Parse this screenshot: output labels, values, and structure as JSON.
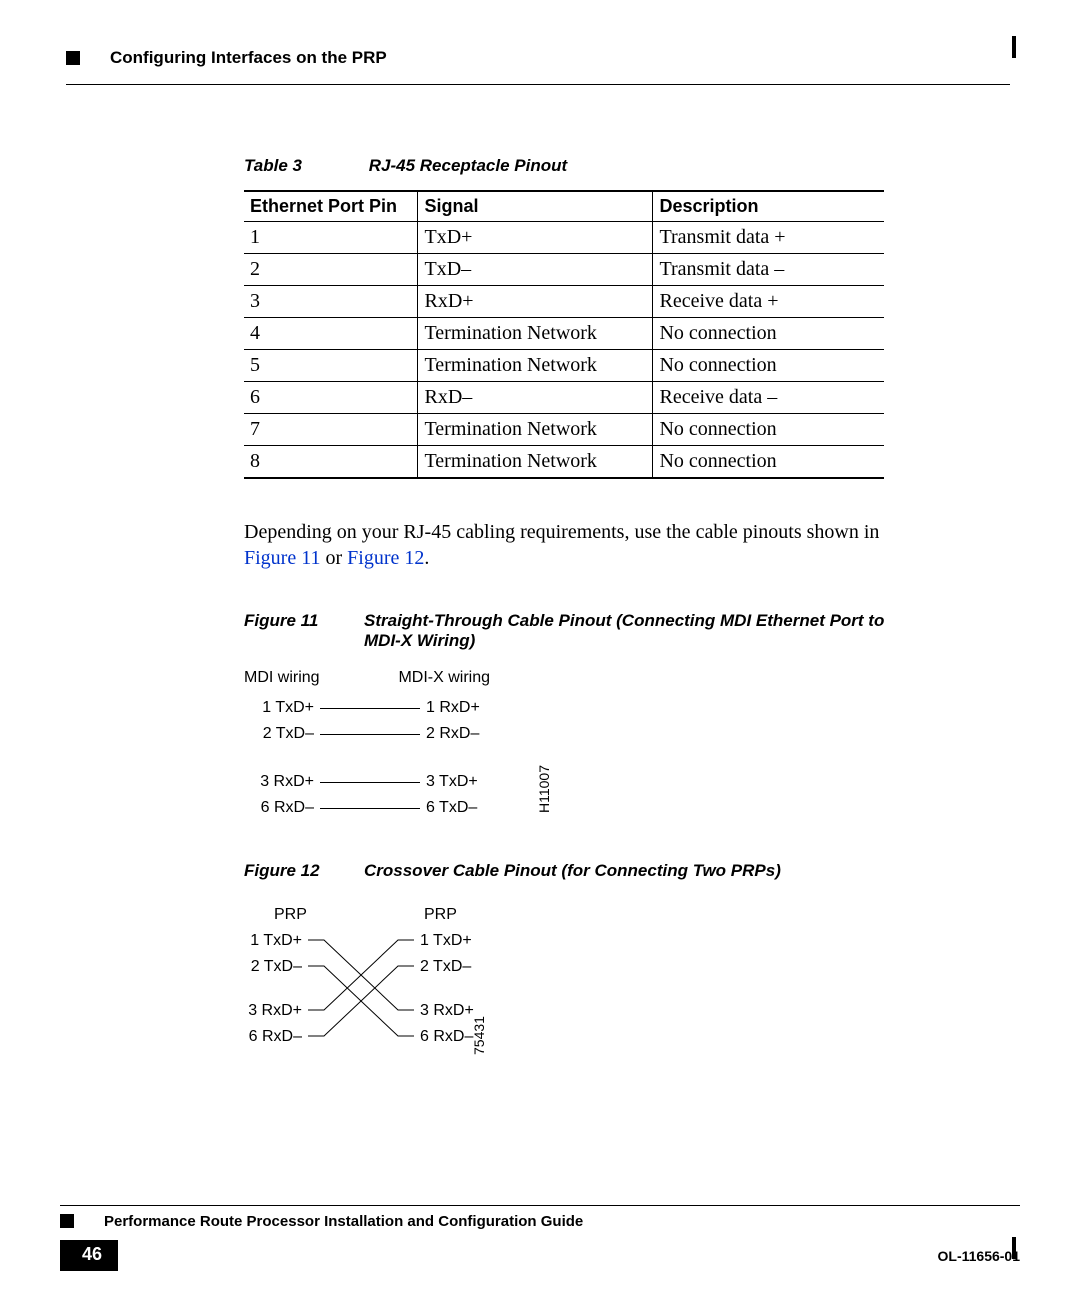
{
  "header": {
    "section_title": "Configuring Interfaces on the PRP"
  },
  "table3": {
    "caption_no": "Table 3",
    "caption_txt": "RJ-45 Receptacle Pinout",
    "headers": {
      "pin": "Ethernet Port Pin",
      "signal": "Signal",
      "desc": "Description"
    },
    "rows": [
      {
        "pin": "1",
        "signal": "TxD+",
        "desc": "Transmit data +"
      },
      {
        "pin": "2",
        "signal": "TxD–",
        "desc": "Transmit data –"
      },
      {
        "pin": "3",
        "signal": "RxD+",
        "desc": "Receive data +"
      },
      {
        "pin": "4",
        "signal": "Termination Network",
        "desc": "No connection"
      },
      {
        "pin": "5",
        "signal": "Termination Network",
        "desc": "No connection"
      },
      {
        "pin": "6",
        "signal": "RxD–",
        "desc": "Receive data –"
      },
      {
        "pin": "7",
        "signal": "Termination Network",
        "desc": "No connection"
      },
      {
        "pin": "8",
        "signal": "Termination Network",
        "desc": "No connection"
      }
    ]
  },
  "para": {
    "text1": "Depending on your RJ-45 cabling requirements, use the cable pinouts shown in ",
    "link1": "Figure 11",
    "mid": " or ",
    "link2": "Figure 12",
    "end": "."
  },
  "fig11": {
    "no": "Figure 11",
    "title": "Straight-Through Cable Pinout (Connecting MDI Ethernet Port to MDI-X Wiring)",
    "left_head": "MDI wiring",
    "right_head": "MDI-X wiring",
    "rows": [
      {
        "l": "1 TxD+",
        "r": "1 RxD+"
      },
      {
        "l": "2 TxD–",
        "r": "2 RxD–"
      },
      {
        "gap": true
      },
      {
        "l": "3 RxD+",
        "r": "3 TxD+"
      },
      {
        "l": "6 RxD–",
        "r": "6 TxD–"
      }
    ],
    "sideid": "H11007"
  },
  "fig12": {
    "no": "Figure 12",
    "title": "Crossover Cable Pinout (for Connecting Two PRPs)",
    "left_head": "PRP",
    "right_head": "PRP",
    "rows": [
      {
        "l": "1 TxD+",
        "r": "1 TxD+"
      },
      {
        "l": "2 TxD–",
        "r": "2 TxD–"
      },
      {
        "l": "3 RxD+",
        "r": "3 RxD+"
      },
      {
        "l": "6 RxD–",
        "r": "6 RxD–"
      }
    ],
    "sideid": "75431"
  },
  "footer": {
    "guide_title": "Performance Route Processor Installation and Configuration Guide",
    "page_no": "46",
    "doc_id": "OL-11656-01"
  },
  "chart_data": [
    {
      "type": "table",
      "title": "RJ-45 Receptacle Pinout",
      "columns": [
        "Ethernet Port Pin",
        "Signal",
        "Description"
      ],
      "rows": [
        [
          "1",
          "TxD+",
          "Transmit data +"
        ],
        [
          "2",
          "TxD–",
          "Transmit data –"
        ],
        [
          "3",
          "RxD+",
          "Receive data +"
        ],
        [
          "4",
          "Termination Network",
          "No connection"
        ],
        [
          "5",
          "Termination Network",
          "No connection"
        ],
        [
          "6",
          "RxD–",
          "Receive data –"
        ],
        [
          "7",
          "Termination Network",
          "No connection"
        ],
        [
          "8",
          "Termination Network",
          "No connection"
        ]
      ]
    },
    {
      "type": "diagram",
      "title": "Straight-Through Cable Pinout (Connecting MDI Ethernet Port to MDI-X Wiring)",
      "mapping": [
        [
          "1 TxD+",
          "1 RxD+"
        ],
        [
          "2 TxD–",
          "2 RxD–"
        ],
        [
          "3 RxD+",
          "3 TxD+"
        ],
        [
          "6 RxD–",
          "6 TxD–"
        ]
      ]
    },
    {
      "type": "diagram",
      "title": "Crossover Cable Pinout (for Connecting Two PRPs)",
      "mapping": [
        [
          "1 TxD+",
          "3 RxD+"
        ],
        [
          "2 TxD–",
          "6 RxD–"
        ],
        [
          "3 RxD+",
          "1 TxD+"
        ],
        [
          "6 RxD–",
          "2 TxD–"
        ]
      ]
    }
  ]
}
